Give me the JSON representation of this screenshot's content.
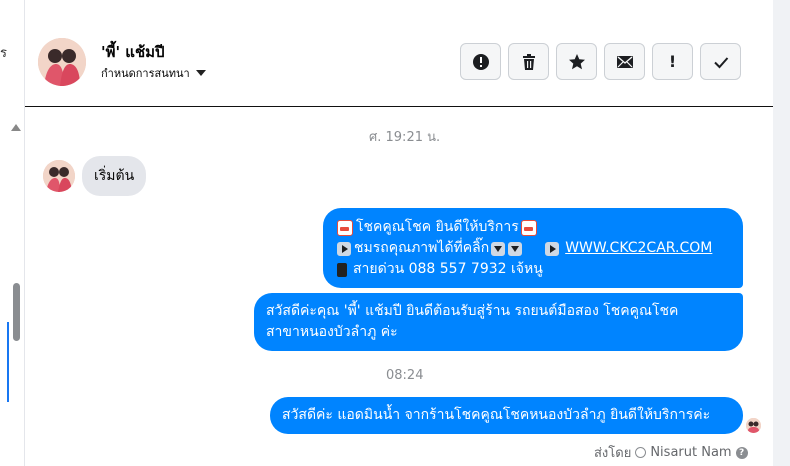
{
  "left_strip": {
    "edge_char": "ร"
  },
  "header": {
    "contact_name": "'พี้' แช้มปี",
    "settings_label": "กำหนดการสนทนา",
    "toolbar": [
      {
        "name": "report-button",
        "icon": "alert-circle-icon"
      },
      {
        "name": "delete-button",
        "icon": "trash-icon"
      },
      {
        "name": "star-button",
        "icon": "star-icon"
      },
      {
        "name": "mark-unread-button",
        "icon": "envelope-icon"
      },
      {
        "name": "important-button",
        "icon": "exclamation-icon",
        "label": "!"
      },
      {
        "name": "done-button",
        "icon": "check-icon"
      }
    ]
  },
  "messages": {
    "timestamp_1": "ศ. 19:21 น.",
    "incoming_1": "เริ่มต้น",
    "out_1": {
      "line1": "โชคคูณโชค ยินดีให้บริการ",
      "line2_prefix": "ชมรถคุณภาพได้ที่คลิ๊ก",
      "line2_link": "WWW.CKC2CAR.COM",
      "line3": "สายด่วน 088 557 7932 เจ้หนู"
    },
    "out_2": {
      "line1": "สวัสดีค่ะคุณ 'พี้' แช้มปี ยินดีต้อนรับสู่ร้าน รถยนต์มือสอง โชคคูณโชค",
      "line2": "สาขาหนองบัวลำภู ค่ะ"
    },
    "timestamp_2": "08:24",
    "out_3": "สวัสดีค่ะ แอดมินน้ำ จากร้านโชคคูณโชคหนองบัวลำภู ยินดีให้บริการค่ะ",
    "sent_by_label": "ส่งโดย",
    "sent_by_name": "Nisarut Nam"
  },
  "colors": {
    "bubble_out": "#0084ff",
    "bubble_in": "#e4e6eb",
    "timestamp": "#8a8d91"
  }
}
